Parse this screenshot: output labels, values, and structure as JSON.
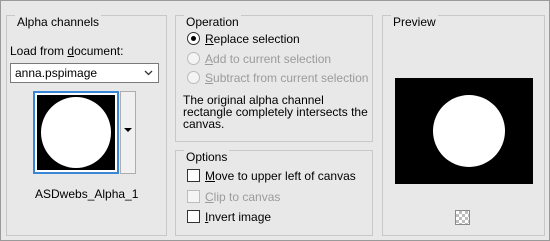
{
  "alpha": {
    "title": "Alpha channels",
    "load_label_pre": "Load from ",
    "load_label_u": "d",
    "load_label_post": "ocument:",
    "document_value": "anna.pspimage",
    "channel_name": "ASDwebs_Alpha_1"
  },
  "operation": {
    "title": "Operation",
    "options": [
      {
        "u": "R",
        "rest": "eplace selection",
        "selected": true,
        "enabled": true
      },
      {
        "u": "A",
        "rest": "dd to current selection",
        "selected": false,
        "enabled": false
      },
      {
        "u": "S",
        "rest": "ubtract from current selection",
        "selected": false,
        "enabled": false
      }
    ],
    "message_line1": "The original alpha channel",
    "message_line2": "rectangle completely intersects the",
    "message_line3": "canvas."
  },
  "options": {
    "title": "Options",
    "items": [
      {
        "u": "M",
        "rest": "ove to upper left of canvas",
        "checked": false,
        "enabled": true
      },
      {
        "u": "C",
        "rest": "lip to canvas",
        "checked": false,
        "enabled": false
      },
      {
        "u": "I",
        "rest": "nvert image",
        "checked": false,
        "enabled": true
      }
    ]
  },
  "preview": {
    "title": "Preview"
  },
  "icons": {
    "combo_arrow": "chevron-down-icon",
    "thumb_drop": "triangle-down-icon",
    "pan": "checkerboard-pan-icon"
  }
}
